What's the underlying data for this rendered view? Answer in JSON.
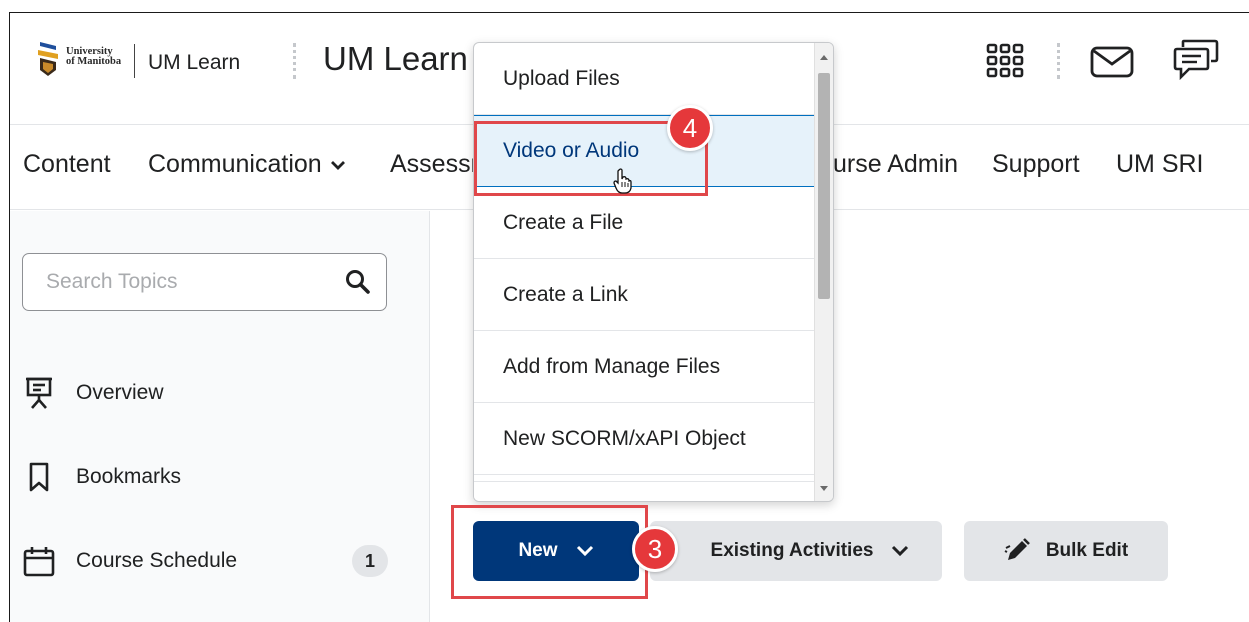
{
  "header": {
    "logo_text_line1": "University",
    "logo_text_line2": "of Manitoba",
    "app_name": "UM Learn",
    "course_title": "UM Learn",
    "icons": [
      "waffle-grid-icon",
      "mail-icon",
      "chat-icon"
    ]
  },
  "nav": {
    "items": [
      {
        "label": "Content"
      },
      {
        "label": "Communication"
      },
      {
        "label": "Assessm"
      },
      {
        "label": "urse Admin"
      },
      {
        "label": "Support"
      },
      {
        "label": "UM SRI"
      }
    ]
  },
  "sidebar": {
    "search_placeholder": "Search Topics",
    "items": [
      {
        "label": "Overview",
        "icon": "presentation-icon"
      },
      {
        "label": "Bookmarks",
        "icon": "bookmark-icon"
      },
      {
        "label": "Course Schedule",
        "icon": "calendar-icon",
        "count": "1"
      }
    ]
  },
  "actions": {
    "new_label": "New",
    "existing_label": "Existing Activities",
    "bulk_label": "Bulk Edit"
  },
  "dropdown": {
    "items": [
      {
        "label": "Upload Files"
      },
      {
        "label": "Video or Audio"
      },
      {
        "label": "Create a File"
      },
      {
        "label": "Create a Link"
      },
      {
        "label": "Add from Manage Files"
      },
      {
        "label": "New SCORM/xAPI Object"
      }
    ]
  },
  "annotations": {
    "step_new": "3",
    "step_video": "4"
  },
  "colors": {
    "primary": "#00377a",
    "highlight": "#e0474a",
    "secondary_button": "#e3e5e8"
  }
}
